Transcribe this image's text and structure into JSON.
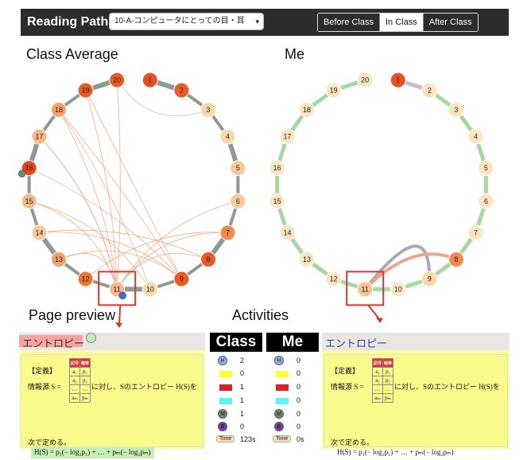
{
  "app": {
    "title": "Reading Path"
  },
  "document_select": {
    "value": "10-A-コンピュータにとっての目・耳"
  },
  "tabs": [
    {
      "label": "Before Class"
    },
    {
      "label": "In Class",
      "active": true
    },
    {
      "label": "After Class"
    }
  ],
  "headings": {
    "class_average": "Class Average",
    "me": "Me",
    "page_preview": "Page preview",
    "activities": "Activities"
  },
  "graphs": {
    "class_average": {
      "nodes": [
        {
          "id": "1",
          "color": "#e8501f"
        },
        {
          "id": "2",
          "color": "#ec5b25"
        },
        {
          "id": "3",
          "color": "#f9d8a8"
        },
        {
          "id": "4",
          "color": "#f9d8a8"
        },
        {
          "id": "5",
          "color": "#f8c99a"
        },
        {
          "id": "6",
          "color": "#f8c99a"
        },
        {
          "id": "7",
          "color": "#f18a4e"
        },
        {
          "id": "8",
          "color": "#ec5b25"
        },
        {
          "id": "9",
          "color": "#ec5b25"
        },
        {
          "id": "10",
          "color": "#f9d8a8"
        },
        {
          "id": "11",
          "color": "#f6b886"
        },
        {
          "id": "12",
          "color": "#ef7439"
        },
        {
          "id": "13",
          "color": "#f4a26c"
        },
        {
          "id": "14",
          "color": "#f8c99a"
        },
        {
          "id": "15",
          "color": "#f6b886"
        },
        {
          "id": "16",
          "color": "#e8451b"
        },
        {
          "id": "17",
          "color": "#f6b886"
        },
        {
          "id": "18",
          "color": "#f4a26c"
        },
        {
          "id": "19",
          "color": "#ec5b25"
        },
        {
          "id": "20",
          "color": "#ec5b25"
        }
      ],
      "markers": {
        "M": "16",
        "H": "11"
      }
    },
    "me": {
      "nodes": [
        {
          "id": "1",
          "color": "#e8501f"
        },
        {
          "id": "2",
          "color": "#fbe4bf"
        },
        {
          "id": "3",
          "color": "#fbe4bf"
        },
        {
          "id": "4",
          "color": "#fbe4bf"
        },
        {
          "id": "5",
          "color": "#fbe4bf"
        },
        {
          "id": "6",
          "color": "#fbe4bf"
        },
        {
          "id": "7",
          "color": "#fbe4bf"
        },
        {
          "id": "8",
          "color": "#f18a4e"
        },
        {
          "id": "9",
          "color": "#f9d8a8"
        },
        {
          "id": "10",
          "color": "#fbe4bf"
        },
        {
          "id": "11",
          "color": "#f6c48f"
        },
        {
          "id": "12",
          "color": "#fbe4bf"
        },
        {
          "id": "13",
          "color": "#fbe4bf"
        },
        {
          "id": "14",
          "color": "#fbe4bf"
        },
        {
          "id": "15",
          "color": "#fbe4bf"
        },
        {
          "id": "16",
          "color": "#fbe4bf"
        },
        {
          "id": "17",
          "color": "#fbe4bf"
        },
        {
          "id": "18",
          "color": "#fbe4bf"
        },
        {
          "id": "19",
          "color": "#fbe4bf"
        },
        {
          "id": "20",
          "color": "#fbe4bf"
        }
      ]
    }
  },
  "preview_class": {
    "title": "エントロピー",
    "definition": "【定義】",
    "info_prefix": "情報源 S =",
    "info_suffix": "に対し、Sのエントロピー H(S)を",
    "table_headers": [
      "記号",
      "確率"
    ],
    "table_rows": [
      [
        "a₁",
        "p₁"
      ],
      [
        "a₂",
        "p₂"
      ],
      [
        "…",
        "…"
      ],
      [
        "aₘ",
        "pₘ"
      ]
    ],
    "next": "次で定める。",
    "formula": "H(S) = p₁(− log₂p₁) + … + pₘ(− log₂pₘ)"
  },
  "preview_me": {
    "title": "エントロピー"
  },
  "activities": {
    "class": {
      "title": "Class",
      "counts": [
        "2",
        "0",
        "1",
        "1",
        "1",
        "0"
      ],
      "time": "123s"
    },
    "me": {
      "title": "Me",
      "counts": [
        "0",
        "0",
        "0",
        "0",
        "0",
        "0"
      ],
      "time": "0s"
    },
    "icons": {
      "highlight": "H",
      "memo": "M",
      "bookmark": "B",
      "time": "Time"
    },
    "colors": {
      "yellow": "#ffff33",
      "red": "#e02020",
      "cyan": "#5ff3f3",
      "H": "#8fb3f0",
      "M": "#6d8e6d",
      "B": "#7e3fa8"
    }
  },
  "colors": {
    "arc_gray": "#8f9a92",
    "arc_green": "#a6d9a0",
    "link_orange": "#f0a07a",
    "callout_red": "#d33a2c"
  }
}
